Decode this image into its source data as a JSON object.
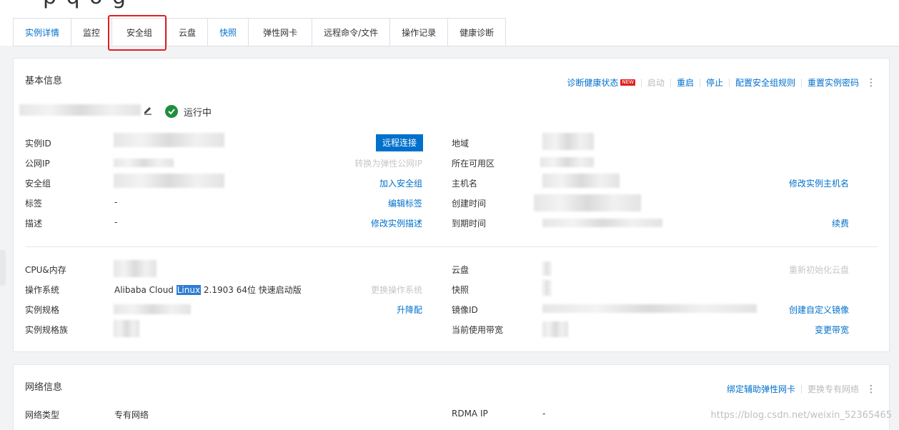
{
  "tabs": [
    {
      "label": "实例详情",
      "state": "active"
    },
    {
      "label": "监控",
      "state": "normal"
    },
    {
      "label": "安全组",
      "state": "normal"
    },
    {
      "label": "云盘",
      "state": "normal"
    },
    {
      "label": "快照",
      "state": "link"
    },
    {
      "label": "弹性网卡",
      "state": "normal"
    },
    {
      "label": "远程命令/文件",
      "state": "normal"
    },
    {
      "label": "操作记录",
      "state": "normal"
    },
    {
      "label": "健康诊断",
      "state": "normal"
    }
  ],
  "basic": {
    "title": "基本信息",
    "actions": {
      "diagnose": "诊断健康状态",
      "new_badge": "NEW",
      "start": "启动",
      "restart": "重启",
      "stop": "停止",
      "config_sg": "配置安全组规则",
      "reset_pwd": "重置实例密码"
    },
    "status": "运行中",
    "rows1_left": [
      {
        "label": "实例ID",
        "action": "远程连接",
        "action_type": "button"
      },
      {
        "label": "公网IP",
        "action": "转换为弹性公网IP",
        "action_type": "disabled"
      },
      {
        "label": "安全组",
        "action": "加入安全组",
        "action_type": "link"
      },
      {
        "label": "标签",
        "value": "-",
        "action": "编辑标签",
        "action_type": "link"
      },
      {
        "label": "描述",
        "value": "-",
        "action": "修改实例描述",
        "action_type": "link"
      }
    ],
    "rows1_right": [
      {
        "label": "地域",
        "action": ""
      },
      {
        "label": "所在可用区",
        "action": ""
      },
      {
        "label": "主机名",
        "action": "修改实例主机名"
      },
      {
        "label": "创建时间",
        "action": ""
      },
      {
        "label": "到期时间",
        "action": "续费"
      }
    ],
    "rows2_left": [
      {
        "label": "CPU&内存",
        "action": "",
        "action_type": "none"
      },
      {
        "label": "操作系统",
        "value_pre": "Alibaba Cloud ",
        "value_sel": "Linux",
        "value_post": " 2.1903 64位 快速启动版",
        "action": "更换操作系统",
        "action_type": "disabled"
      },
      {
        "label": "实例规格",
        "action": "升降配",
        "action_type": "link"
      },
      {
        "label": "实例规格族",
        "action": "",
        "action_type": "none"
      }
    ],
    "rows2_right": [
      {
        "label": "云盘",
        "action": "重新初始化云盘",
        "action_type": "disabled"
      },
      {
        "label": "快照",
        "action": "",
        "action_type": "none"
      },
      {
        "label": "镜像ID",
        "action": "创建自定义镜像",
        "action_type": "link"
      },
      {
        "label": "当前使用带宽",
        "action": "变更带宽",
        "action_type": "link"
      }
    ]
  },
  "network": {
    "title": "网络信息",
    "bind_nic": "绑定辅助弹性网卡",
    "change_vpc": "更换专有网络",
    "rows": [
      {
        "label": "网络类型",
        "value": "专有网络"
      },
      {
        "label": "RDMA IP",
        "value": "-"
      }
    ]
  },
  "watermark": "https://blog.csdn.net/weixin_52365465",
  "colors": {
    "accent": "#0070cc",
    "status_ok": "#1e8e3e",
    "highlight": "#e02020"
  }
}
